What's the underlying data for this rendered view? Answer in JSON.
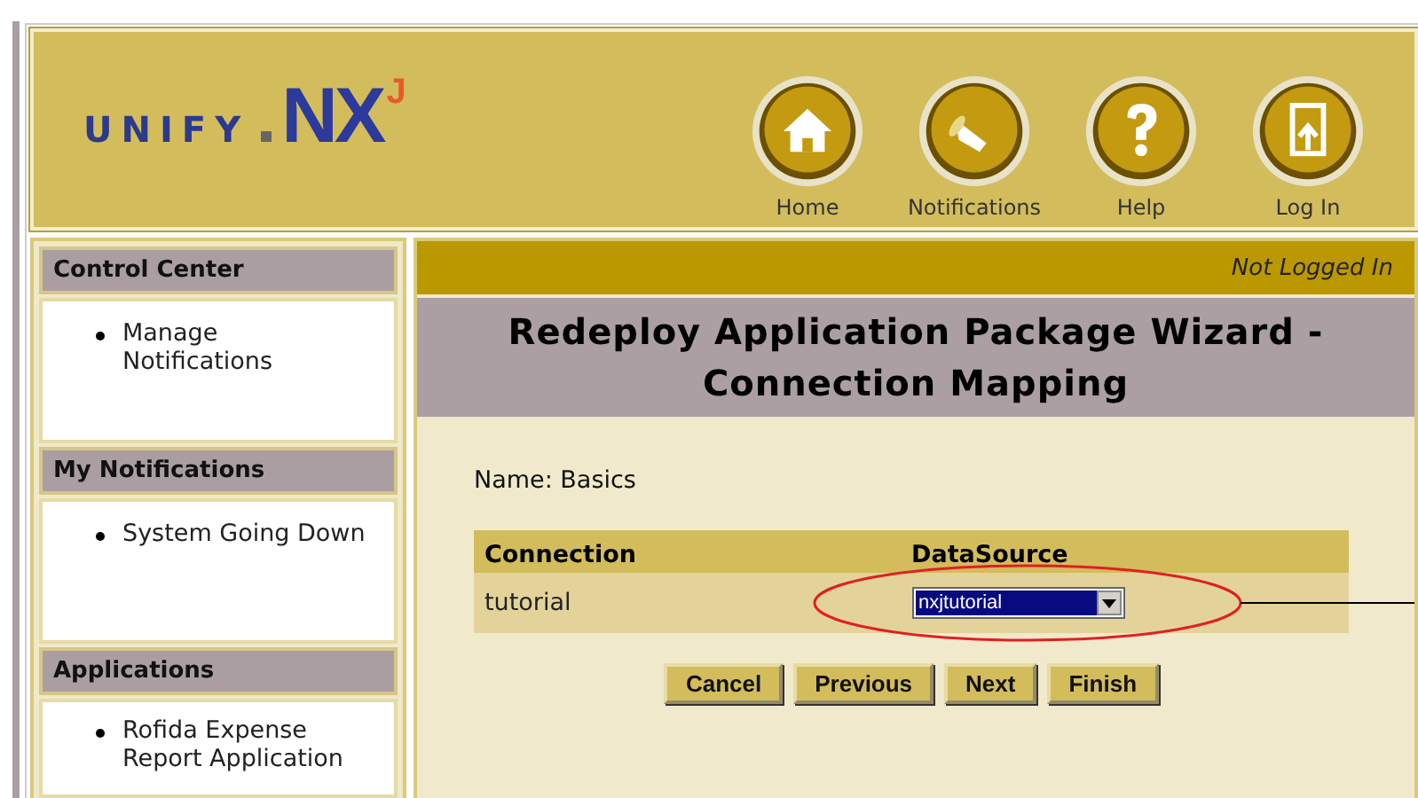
{
  "logo": {
    "brand": "UNIFY",
    "product": "NX",
    "superscript": "J"
  },
  "nav": [
    {
      "label": "Home",
      "kind": "home"
    },
    {
      "label": "Notifications",
      "kind": "megaphone"
    },
    {
      "label": "Help",
      "kind": "help"
    },
    {
      "label": "Log In",
      "kind": "login"
    }
  ],
  "sidebar": [
    {
      "title": "Control Center",
      "items": [
        "Manage Notifications"
      ]
    },
    {
      "title": "My Notifications",
      "items": [
        "System Going Down"
      ]
    },
    {
      "title": "Applications",
      "items": [
        "Rofida Expense Report Application"
      ]
    }
  ],
  "status": "Not Logged In",
  "page_title": "Redeploy Application Package Wizard - Connection Mapping",
  "name_line": "Name: Basics",
  "table": {
    "columns": [
      "Connection",
      "DataSource"
    ],
    "rows": [
      {
        "connection": "tutorial",
        "datasource": "nxjtutorial"
      }
    ]
  },
  "buttons": [
    "Cancel",
    "Previous",
    "Next",
    "Finish"
  ]
}
